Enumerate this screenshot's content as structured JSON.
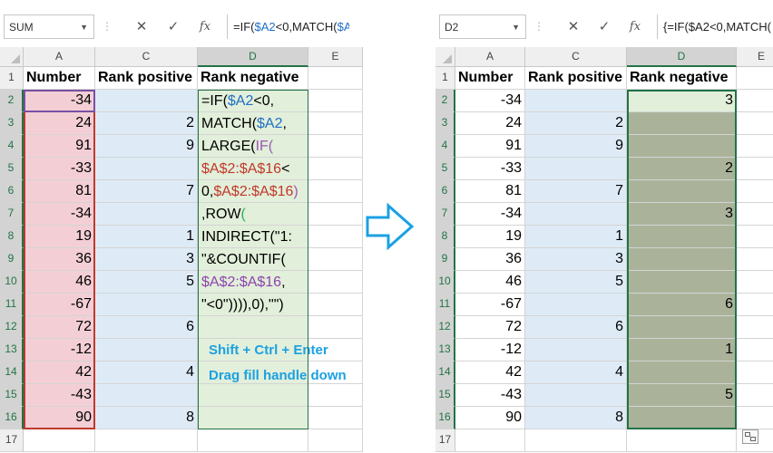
{
  "left": {
    "namebox": "SUM",
    "formula_prefix": "=IF(",
    "formula_ref": "$A2",
    "formula_rest": "<0,MATCH(",
    "formula_ref2": "$A",
    "col_headers": [
      "A",
      "C",
      "D",
      "E"
    ],
    "row_numbers": [
      "1",
      "2",
      "3",
      "4",
      "5",
      "6",
      "7",
      "8",
      "9",
      "10",
      "11",
      "12",
      "13",
      "14",
      "15",
      "16",
      "17"
    ],
    "headers": [
      "Number",
      "Rank positive",
      "Rank negative"
    ],
    "numbers": [
      "-34",
      "24",
      "91",
      "-33",
      "81",
      "-34",
      "19",
      "36",
      "46",
      "-67",
      "72",
      "-12",
      "42",
      "-43",
      "90"
    ],
    "rank_positive": [
      "",
      "2",
      "9",
      "",
      "7",
      "",
      "1",
      "3",
      "5",
      "",
      "6",
      "",
      "4",
      "",
      "8"
    ],
    "formula_lines": [
      [
        "=IF(",
        "$A2",
        "<0,"
      ],
      [
        "MATCH(",
        "$A2",
        ","
      ],
      [
        "LARGE(",
        "IF(",
        ""
      ],
      [
        "$A$2:$A$16",
        "<",
        ""
      ],
      [
        "0,",
        "$A$2:$A$16",
        ")"
      ],
      [
        ",ROW",
        "(",
        ""
      ],
      [
        "INDIRECT(",
        "\"1:",
        ""
      ],
      [
        "\"&COUNTIF(",
        "",
        ""
      ],
      [
        "$A$2:$A$16",
        ",",
        ""
      ],
      [
        "\"<0\"))))",
        ",0),\"\")",
        ""
      ]
    ],
    "notes": [
      "Shift + Ctrl + Enter",
      "Drag fill handle down"
    ]
  },
  "right": {
    "namebox": "D2",
    "formula": "{=IF($A2<0,MATCH(",
    "col_headers": [
      "A",
      "C",
      "D",
      "E"
    ],
    "row_numbers": [
      "1",
      "2",
      "3",
      "4",
      "5",
      "6",
      "7",
      "8",
      "9",
      "10",
      "11",
      "12",
      "13",
      "14",
      "15",
      "16",
      "17"
    ],
    "headers": [
      "Number",
      "Rank positive",
      "Rank negative"
    ],
    "numbers": [
      "-34",
      "24",
      "91",
      "-33",
      "81",
      "-34",
      "19",
      "36",
      "46",
      "-67",
      "72",
      "-12",
      "42",
      "-43",
      "90"
    ],
    "rank_positive": [
      "",
      "2",
      "9",
      "",
      "7",
      "",
      "1",
      "3",
      "5",
      "",
      "6",
      "",
      "4",
      "",
      "8"
    ],
    "rank_negative": [
      "3",
      "",
      "",
      "2",
      "",
      "3",
      "",
      "",
      "",
      "6",
      "",
      "1",
      "",
      "5",
      ""
    ]
  },
  "icons": {
    "cancel": "✕",
    "enter": "✓",
    "fx": "fx",
    "arrow": "right-arrow-icon"
  }
}
